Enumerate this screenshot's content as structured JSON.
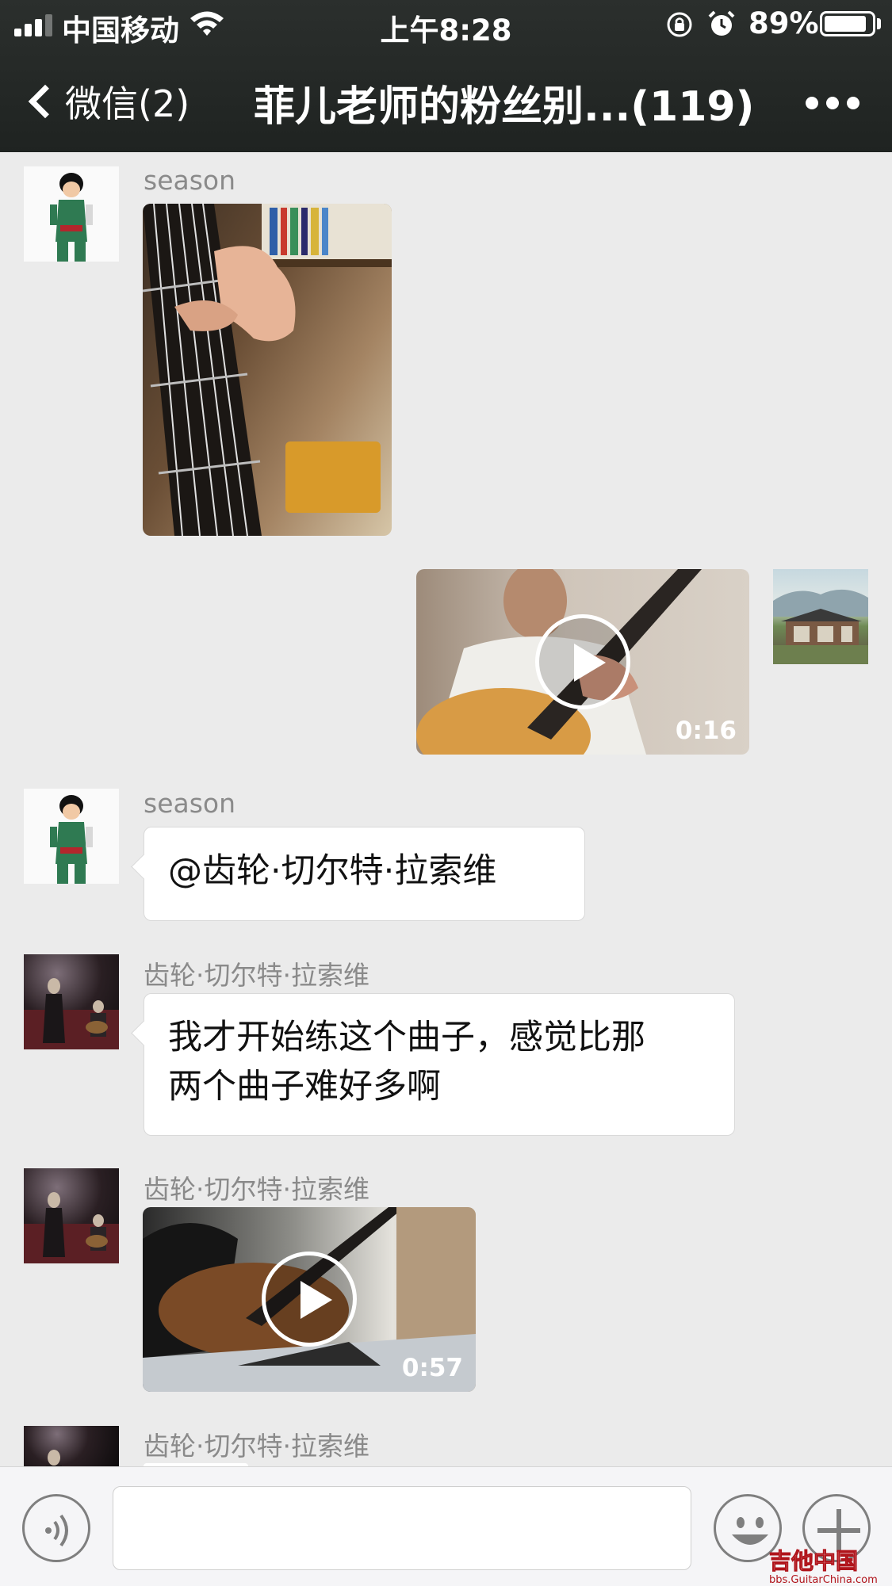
{
  "status_bar": {
    "carrier": "中国移动",
    "time": "上午8:28",
    "battery_percent": "89%",
    "battery_level": 0.89,
    "signal_bars": 3
  },
  "nav": {
    "back_label": "微信(2)",
    "title": "菲儿老师的粉丝别...(119)"
  },
  "messages": [
    {
      "type": "image",
      "sender": "season"
    },
    {
      "type": "video",
      "sender": "self",
      "duration": "0:16"
    },
    {
      "type": "text",
      "sender": "season",
      "text": "@齿轮·切尔特·拉索维"
    },
    {
      "type": "text",
      "sender": "齿轮·切尔特·拉索维",
      "lines": [
        "我才开始练这个曲子，感觉比那",
        "两个曲子难好多啊"
      ]
    },
    {
      "type": "video",
      "sender": "齿轮·切尔特·拉索维",
      "duration": "0:57"
    },
    {
      "type": "partial",
      "sender": "齿轮·切尔特·拉索维"
    }
  ],
  "input_bar": {
    "voice_icon": "voice-icon",
    "emoji_icon": "emoji-icon",
    "plus_icon": "plus-icon"
  },
  "watermark": {
    "text": "吉他中国",
    "url": "bbs.GuitarChina.com"
  },
  "colors": {
    "nav_bg": "#262a28",
    "chat_bg": "#ebebeb",
    "bubble_bg": "#ffffff",
    "watermark_red": "#b0141b"
  }
}
